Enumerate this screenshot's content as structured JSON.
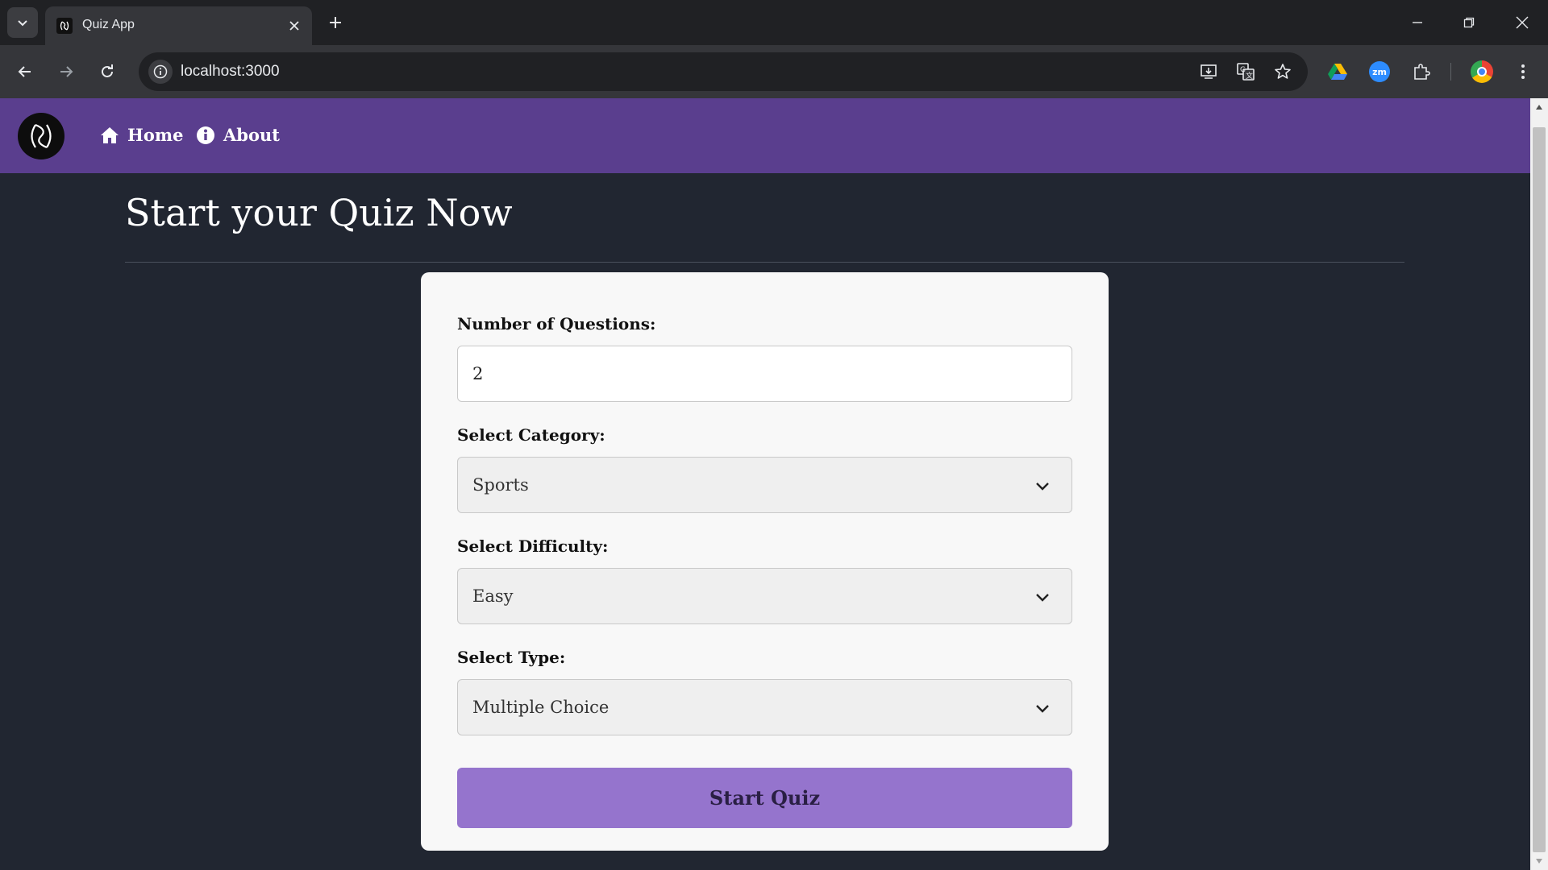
{
  "browser": {
    "tab_title": "Quiz App",
    "url": "localhost:3000",
    "icons": [
      "tab-list-icon",
      "close-icon",
      "plus-icon",
      "minimize-icon",
      "restore-icon",
      "back-icon",
      "forward-icon",
      "reload-icon",
      "info-icon",
      "install-icon",
      "translate-icon",
      "star-icon",
      "drive-icon",
      "zoom-icon",
      "puzzle-icon",
      "profile-icon",
      "more-icon"
    ],
    "zoom_ext_label": "zm"
  },
  "nav": {
    "home": "Home",
    "about": "About"
  },
  "page": {
    "title": "Start your Quiz Now"
  },
  "form": {
    "questions_label": "Number of Questions:",
    "questions_value": "2",
    "category_label": "Select Category:",
    "category_value": "Sports",
    "difficulty_label": "Select Difficulty:",
    "difficulty_value": "Easy",
    "type_label": "Select Type:",
    "type_value": "Multiple Choice",
    "submit_label": "Start Quiz"
  },
  "colors": {
    "appbar": "#5a3e8e",
    "page_bg": "#212631",
    "card_bg": "#f8f8f8",
    "button": "#9574cd"
  }
}
